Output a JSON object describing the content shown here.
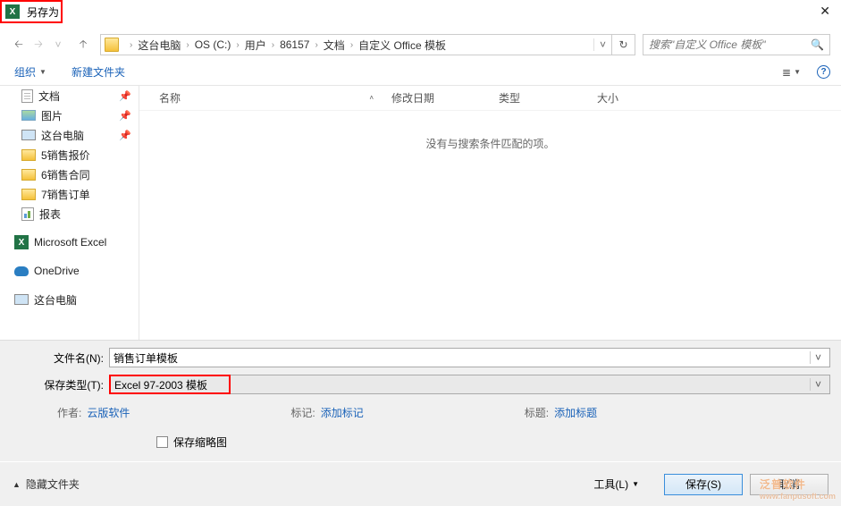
{
  "title": "另存为",
  "nav": {
    "back_enabled": true,
    "crumbs": [
      "这台电脑",
      "OS (C:)",
      "用户",
      "86157",
      "文档",
      "自定义 Office 模板"
    ],
    "search_placeholder": "搜索\"自定义 Office 模板\""
  },
  "toolbar": {
    "organize": "组织",
    "new_folder": "新建文件夹"
  },
  "sidebar": {
    "items": [
      {
        "label": "文档",
        "icon": "doc",
        "pinned": true
      },
      {
        "label": "图片",
        "icon": "pic",
        "pinned": true
      },
      {
        "label": "这台电脑",
        "icon": "monitor",
        "pinned": true
      },
      {
        "label": "5销售报价",
        "icon": "folder"
      },
      {
        "label": "6销售合同",
        "icon": "folder"
      },
      {
        "label": "7销售订单",
        "icon": "folder"
      },
      {
        "label": "报表",
        "icon": "report"
      }
    ],
    "excel_label": "Microsoft Excel",
    "onedrive_label": "OneDrive",
    "pc_label": "这台电脑",
    "more": "⌄  ..."
  },
  "columns": {
    "name": "名称",
    "date": "修改日期",
    "type": "类型",
    "size": "大小"
  },
  "empty_msg": "没有与搜索条件匹配的项。",
  "filename": {
    "label": "文件名(N):",
    "value": "销售订单模板"
  },
  "filetype": {
    "label": "保存类型(T):",
    "value": "Excel 97-2003 模板"
  },
  "meta": {
    "author_label": "作者:",
    "author_value": "云版软件",
    "tag_label": "标记:",
    "tag_value": "添加标记",
    "title_label": "标题:",
    "title_value": "添加标题"
  },
  "thumbnail_label": "保存缩略图",
  "hide_folders": "隐藏文件夹",
  "tools_label": "工具(L)",
  "save_label": "保存(S)",
  "cancel_label": "取消",
  "watermark": {
    "brand": "泛普软件",
    "url": "www.fanpusoft.com"
  }
}
